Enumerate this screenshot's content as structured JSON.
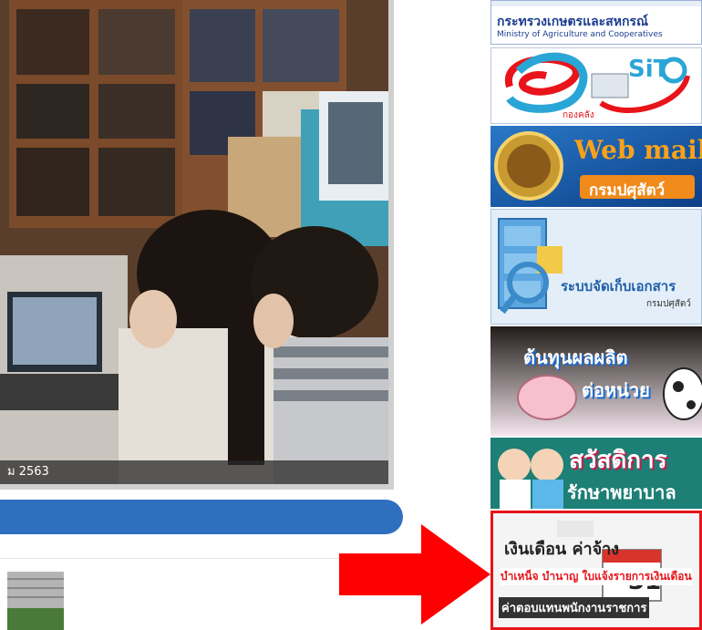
{
  "photo": {
    "caption": "ม 2563"
  },
  "banners": {
    "moac": {
      "title": "กระทรวงเกษตรและสหกรณ์",
      "subtitle": "Ministry of Agriculture and Cooperatives"
    },
    "siit": {
      "logo_text": "SiT",
      "org": "กองคลัง"
    },
    "webmail": {
      "title": "Web mail",
      "subtitle": "กรมปศุสัตว์"
    },
    "docs": {
      "title": "ระบบจัดเก็บเอกสาร",
      "subtitle": "กรมปศุสัตว์"
    },
    "cost": {
      "line1": "ต้นทุนผลผลิต",
      "line2": "ต่อหน่วย"
    },
    "welfare": {
      "line1": "สวัสดิการ",
      "line2": "รักษาพยาบาล"
    },
    "salary": {
      "line1": "เงินเดือน ค่าจ้าง",
      "line2": "บำเหน็จ บำนาญ ใบแจ้งรายการเงินเดือน",
      "line3": "ค่าตอบแทนพนักงานราชการ",
      "calendar_day": "31"
    }
  },
  "colors": {
    "accent_blue": "#2f6fc0",
    "highlight_red": "#e8141a",
    "arrow_red": "#ff0000"
  }
}
